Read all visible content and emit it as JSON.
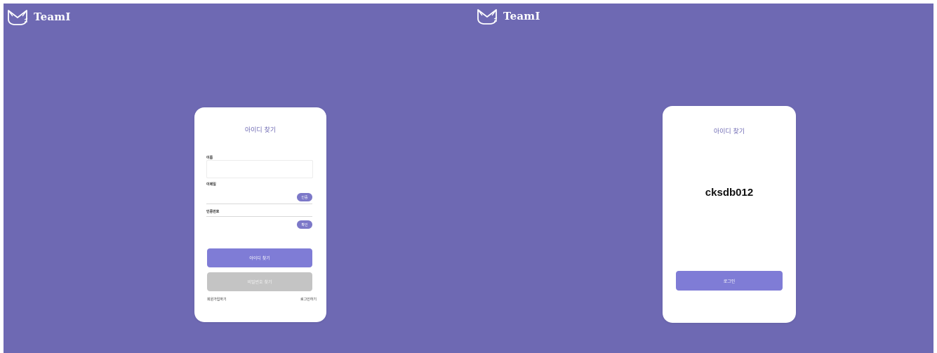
{
  "colors": {
    "background": "#6e69b3",
    "card": "#ffffff",
    "primary_button": "#7f7cd6",
    "disabled_button": "#c4c4c4",
    "title_text": "#6e69b3"
  },
  "left_screen": {
    "logo_text": "TeamI",
    "title": "아이디 찾기",
    "name_label": "이름",
    "name_value": "",
    "email_label": "이메일",
    "email_value": "",
    "email_button": "인증",
    "code_label": "인증번호",
    "code_value": "",
    "code_button": "확인",
    "find_id_button": "아이디 찾기",
    "find_password_button": "비밀번호 찾기",
    "signup_link": "회원가입하기",
    "login_link": "로그인하기"
  },
  "right_screen": {
    "logo_text": "TeamI",
    "title": "아이디 찾기",
    "found_id": "cksdb012",
    "login_button": "로그인"
  }
}
